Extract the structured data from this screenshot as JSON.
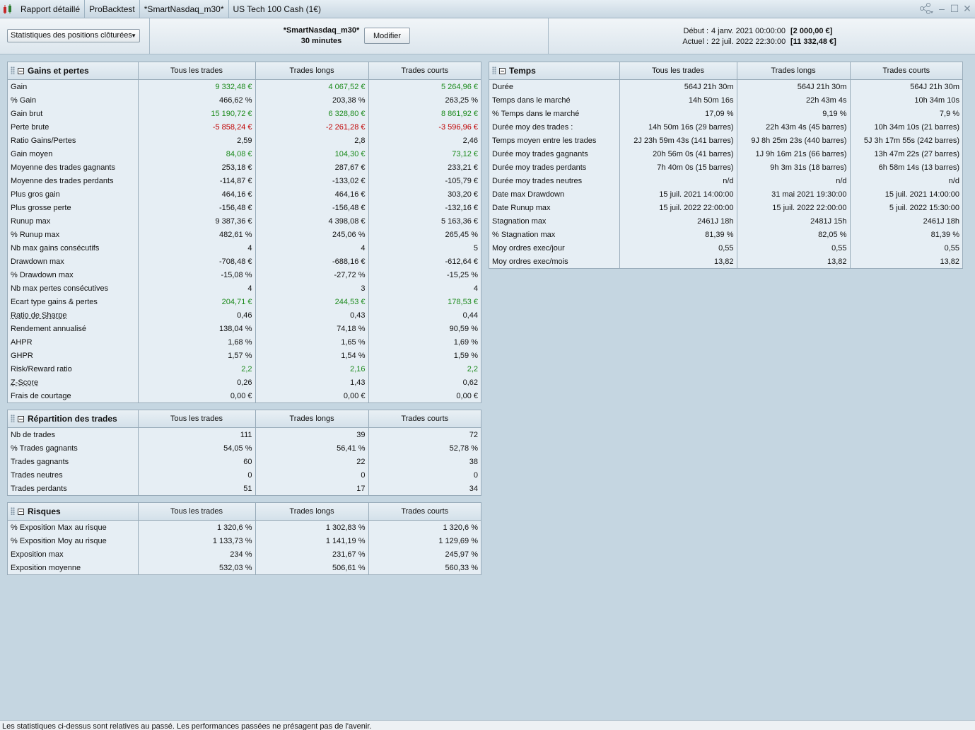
{
  "titlebar": {
    "tabs": [
      "Rapport détaillé",
      "ProBacktest",
      "*SmartNasdaq_m30*",
      "US Tech 100 Cash (1€)"
    ]
  },
  "header": {
    "selector": "Statistiques des positions clôturées",
    "system_name": "*SmartNasdaq_m30*",
    "timeframe": "30 minutes",
    "modify_label": "Modifier",
    "start_label": "Début :",
    "start_date": "4 janv. 2021 00:00:00",
    "start_capital": "[2 000,00 €]",
    "current_label": "Actuel :",
    "current_date": "22 juil. 2022 22:30:00",
    "current_capital": "[11 332,48 €]"
  },
  "colors": {
    "positive": "#1b8a1b",
    "negative": "#c00000",
    "background": "#c5d6e1"
  },
  "columns": [
    "Tous les trades",
    "Trades longs",
    "Trades courts"
  ],
  "panels": {
    "gains": {
      "title": "Gains et pertes",
      "rows": [
        {
          "label": "Gain",
          "values": [
            "9 332,48 €",
            "4 067,52 €",
            "5 264,96 €"
          ],
          "tone": "pos"
        },
        {
          "label": "% Gain",
          "values": [
            "466,62 %",
            "203,38 %",
            "263,25 %"
          ]
        },
        {
          "label": "Gain brut",
          "values": [
            "15 190,72 €",
            "6 328,80 €",
            "8 861,92 €"
          ],
          "tone": "pos"
        },
        {
          "label": "Perte brute",
          "values": [
            "-5 858,24 €",
            "-2 261,28 €",
            "-3 596,96 €"
          ],
          "tone": "neg"
        },
        {
          "label": "Ratio Gains/Pertes",
          "values": [
            "2,59",
            "2,8",
            "2,46"
          ]
        },
        {
          "label": "Gain moyen",
          "values": [
            "84,08 €",
            "104,30 €",
            "73,12 €"
          ],
          "tone": "pos"
        },
        {
          "label": "Moyenne des trades gagnants",
          "values": [
            "253,18 €",
            "287,67 €",
            "233,21 €"
          ]
        },
        {
          "label": "Moyenne des trades perdants",
          "values": [
            "-114,87 €",
            "-133,02 €",
            "-105,79 €"
          ]
        },
        {
          "label": "Plus gros gain",
          "values": [
            "464,16 €",
            "464,16 €",
            "303,20 €"
          ]
        },
        {
          "label": "Plus grosse perte",
          "values": [
            "-156,48 €",
            "-156,48 €",
            "-132,16 €"
          ]
        },
        {
          "label": "Runup max",
          "values": [
            "9 387,36 €",
            "4 398,08 €",
            "5 163,36 €"
          ]
        },
        {
          "label": "% Runup max",
          "values": [
            "482,61 %",
            "245,06 %",
            "265,45 %"
          ]
        },
        {
          "label": "Nb max gains consécutifs",
          "values": [
            "4",
            "4",
            "5"
          ]
        },
        {
          "label": "Drawdown max",
          "values": [
            "-708,48 €",
            "-688,16 €",
            "-612,64 €"
          ]
        },
        {
          "label": "% Drawdown max",
          "values": [
            "-15,08 %",
            "-27,72 %",
            "-15,25 %"
          ]
        },
        {
          "label": "Nb max pertes consécutives",
          "values": [
            "4",
            "3",
            "4"
          ]
        },
        {
          "label": "Ecart type gains & pertes",
          "values": [
            "204,71 €",
            "244,53 €",
            "178,53 €"
          ],
          "tone": "pos"
        },
        {
          "label": "Ratio de Sharpe",
          "values": [
            "0,46",
            "0,43",
            "0,44"
          ],
          "underline": true
        },
        {
          "label": "Rendement annualisé",
          "values": [
            "138,04 %",
            "74,18 %",
            "90,59 %"
          ]
        },
        {
          "label": "AHPR",
          "values": [
            "1,68 %",
            "1,65 %",
            "1,69 %"
          ]
        },
        {
          "label": "GHPR",
          "values": [
            "1,57 %",
            "1,54 %",
            "1,59 %"
          ]
        },
        {
          "label": "Risk/Reward ratio",
          "values": [
            "2,2",
            "2,16",
            "2,2"
          ],
          "tone": "pos"
        },
        {
          "label": "Z-Score",
          "values": [
            "0,26",
            "1,43",
            "0,62"
          ],
          "underline": true
        },
        {
          "label": "Frais de courtage",
          "values": [
            "0,00 €",
            "0,00 €",
            "0,00 €"
          ]
        }
      ]
    },
    "repartition": {
      "title": "Répartition des trades",
      "rows": [
        {
          "label": "Nb de trades",
          "values": [
            "111",
            "39",
            "72"
          ]
        },
        {
          "label": "% Trades gagnants",
          "values": [
            "54,05 %",
            "56,41 %",
            "52,78 %"
          ]
        },
        {
          "label": "Trades gagnants",
          "values": [
            "60",
            "22",
            "38"
          ]
        },
        {
          "label": "Trades neutres",
          "values": [
            "0",
            "0",
            "0"
          ]
        },
        {
          "label": "Trades perdants",
          "values": [
            "51",
            "17",
            "34"
          ]
        }
      ]
    },
    "risques": {
      "title": "Risques",
      "rows": [
        {
          "label": "% Exposition Max au risque",
          "values": [
            "1 320,6 %",
            "1 302,83 %",
            "1 320,6 %"
          ]
        },
        {
          "label": "% Exposition Moy au risque",
          "values": [
            "1 133,73 %",
            "1 141,19 %",
            "1 129,69 %"
          ]
        },
        {
          "label": "Exposition max",
          "values": [
            "234 %",
            "231,67 %",
            "245,97 %"
          ]
        },
        {
          "label": "Exposition moyenne",
          "values": [
            "532,03 %",
            "506,61 %",
            "560,33 %"
          ]
        }
      ]
    },
    "temps": {
      "title": "Temps",
      "rows": [
        {
          "label": "Durée",
          "values": [
            "564J 21h 30m",
            "564J 21h 30m",
            "564J 21h 30m"
          ]
        },
        {
          "label": "Temps dans le marché",
          "values": [
            "14h 50m 16s",
            "22h 43m 4s",
            "10h 34m 10s"
          ]
        },
        {
          "label": "% Temps dans le marché",
          "values": [
            "17,09 %",
            "9,19 %",
            "7,9 %"
          ]
        },
        {
          "label": "Durée moy des trades :",
          "values": [
            "14h 50m 16s (29 barres)",
            "22h 43m 4s (45 barres)",
            "10h 34m 10s (21 barres)"
          ]
        },
        {
          "label": "Temps moyen entre les trades",
          "values": [
            "2J 23h 59m 43s (141 barres)",
            "9J 8h 25m 23s (440 barres)",
            "5J 3h 17m 55s (242 barres)"
          ]
        },
        {
          "label": "Durée moy trades gagnants",
          "values": [
            "20h 56m 0s (41 barres)",
            "1J 9h 16m 21s (66 barres)",
            "13h 47m 22s (27 barres)"
          ]
        },
        {
          "label": "Durée moy trades perdants",
          "values": [
            "7h 40m 0s (15 barres)",
            "9h 3m 31s (18 barres)",
            "6h 58m 14s (13 barres)"
          ]
        },
        {
          "label": "Durée moy trades neutres",
          "values": [
            "n/d",
            "n/d",
            "n/d"
          ]
        },
        {
          "label": "Date max Drawdown",
          "values": [
            "15 juil. 2021 14:00:00",
            "31 mai 2021 19:30:00",
            "15 juil. 2021 14:00:00"
          ]
        },
        {
          "label": "Date Runup max",
          "values": [
            "15 juil. 2022 22:00:00",
            "15 juil. 2022 22:00:00",
            "5 juil. 2022 15:30:00"
          ]
        },
        {
          "label": "Stagnation max",
          "values": [
            "2461J 18h",
            "2481J 15h",
            "2461J 18h"
          ]
        },
        {
          "label": "% Stagnation max",
          "values": [
            "81,39 %",
            "82,05 %",
            "81,39 %"
          ]
        },
        {
          "label": "Moy ordres exec/jour",
          "values": [
            "0,55",
            "0,55",
            "0,55"
          ]
        },
        {
          "label": "Moy ordres exec/mois",
          "values": [
            "13,82",
            "13,82",
            "13,82"
          ]
        }
      ]
    }
  },
  "footer": "Les statistiques ci-dessus sont relatives au passé. Les performances passées ne présagent pas de l'avenir."
}
